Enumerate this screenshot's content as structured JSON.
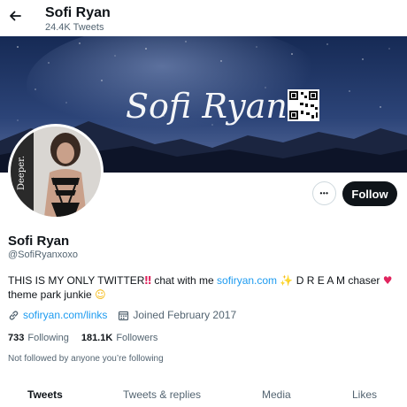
{
  "header": {
    "title": "Sofi Ryan",
    "tweet_count": "24.4K Tweets"
  },
  "banner": {
    "signature_text": "Sofi Ryan"
  },
  "avatar": {
    "side_text": "Deeper."
  },
  "actions": {
    "more_label": "•••",
    "follow_label": "Follow"
  },
  "profile": {
    "display_name": "Sofi Ryan",
    "handle": "@SofiRyanxoxo",
    "bio_part1": "THIS IS MY ONLY TWITTER",
    "bio_part2": " chat with me ",
    "bio_link": "sofiryan.com",
    "bio_part3": " D R E A M chaser ",
    "bio_part4": "theme park junkie ",
    "website": "sofiryan.com/links",
    "joined": "Joined February 2017",
    "following_count": "733",
    "following_label": "Following",
    "followers_count": "181.1K",
    "followers_label": "Followers",
    "follow_note": "Not followed by anyone you’re following"
  },
  "tabs": [
    {
      "label": "Tweets",
      "active": true
    },
    {
      "label": "Tweets & replies",
      "active": false
    },
    {
      "label": "Media",
      "active": false
    },
    {
      "label": "Likes",
      "active": false
    }
  ],
  "colors": {
    "accent": "#1d9bf0",
    "text": "#0f1419",
    "muted": "#536471",
    "follow_button": "#0f1419"
  },
  "icons": [
    "back-arrow-icon",
    "link-icon",
    "calendar-icon",
    "more-icon",
    "qr-code-icon"
  ]
}
